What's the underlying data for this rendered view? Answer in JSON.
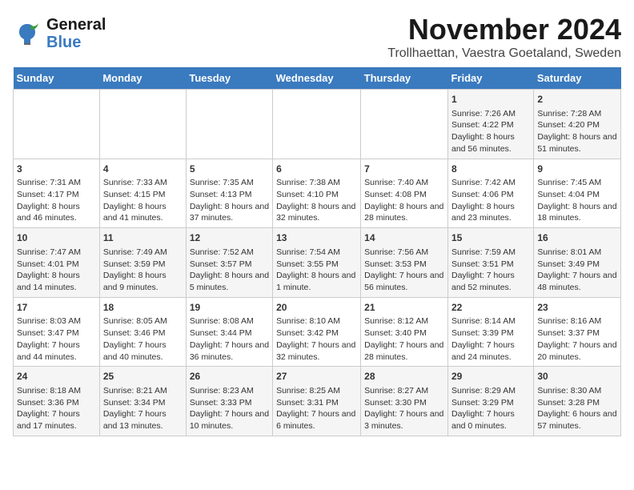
{
  "logo": {
    "text_general": "General",
    "text_blue": "Blue"
  },
  "title": "November 2024",
  "subtitle": "Trollhaettan, Vaestra Goetaland, Sweden",
  "days_of_week": [
    "Sunday",
    "Monday",
    "Tuesday",
    "Wednesday",
    "Thursday",
    "Friday",
    "Saturday"
  ],
  "weeks": [
    [
      {
        "day": "",
        "content": ""
      },
      {
        "day": "",
        "content": ""
      },
      {
        "day": "",
        "content": ""
      },
      {
        "day": "",
        "content": ""
      },
      {
        "day": "",
        "content": ""
      },
      {
        "day": "1",
        "content": "Sunrise: 7:26 AM\nSunset: 4:22 PM\nDaylight: 8 hours and 56 minutes."
      },
      {
        "day": "2",
        "content": "Sunrise: 7:28 AM\nSunset: 4:20 PM\nDaylight: 8 hours and 51 minutes."
      }
    ],
    [
      {
        "day": "3",
        "content": "Sunrise: 7:31 AM\nSunset: 4:17 PM\nDaylight: 8 hours and 46 minutes."
      },
      {
        "day": "4",
        "content": "Sunrise: 7:33 AM\nSunset: 4:15 PM\nDaylight: 8 hours and 41 minutes."
      },
      {
        "day": "5",
        "content": "Sunrise: 7:35 AM\nSunset: 4:13 PM\nDaylight: 8 hours and 37 minutes."
      },
      {
        "day": "6",
        "content": "Sunrise: 7:38 AM\nSunset: 4:10 PM\nDaylight: 8 hours and 32 minutes."
      },
      {
        "day": "7",
        "content": "Sunrise: 7:40 AM\nSunset: 4:08 PM\nDaylight: 8 hours and 28 minutes."
      },
      {
        "day": "8",
        "content": "Sunrise: 7:42 AM\nSunset: 4:06 PM\nDaylight: 8 hours and 23 minutes."
      },
      {
        "day": "9",
        "content": "Sunrise: 7:45 AM\nSunset: 4:04 PM\nDaylight: 8 hours and 18 minutes."
      }
    ],
    [
      {
        "day": "10",
        "content": "Sunrise: 7:47 AM\nSunset: 4:01 PM\nDaylight: 8 hours and 14 minutes."
      },
      {
        "day": "11",
        "content": "Sunrise: 7:49 AM\nSunset: 3:59 PM\nDaylight: 8 hours and 9 minutes."
      },
      {
        "day": "12",
        "content": "Sunrise: 7:52 AM\nSunset: 3:57 PM\nDaylight: 8 hours and 5 minutes."
      },
      {
        "day": "13",
        "content": "Sunrise: 7:54 AM\nSunset: 3:55 PM\nDaylight: 8 hours and 1 minute."
      },
      {
        "day": "14",
        "content": "Sunrise: 7:56 AM\nSunset: 3:53 PM\nDaylight: 7 hours and 56 minutes."
      },
      {
        "day": "15",
        "content": "Sunrise: 7:59 AM\nSunset: 3:51 PM\nDaylight: 7 hours and 52 minutes."
      },
      {
        "day": "16",
        "content": "Sunrise: 8:01 AM\nSunset: 3:49 PM\nDaylight: 7 hours and 48 minutes."
      }
    ],
    [
      {
        "day": "17",
        "content": "Sunrise: 8:03 AM\nSunset: 3:47 PM\nDaylight: 7 hours and 44 minutes."
      },
      {
        "day": "18",
        "content": "Sunrise: 8:05 AM\nSunset: 3:46 PM\nDaylight: 7 hours and 40 minutes."
      },
      {
        "day": "19",
        "content": "Sunrise: 8:08 AM\nSunset: 3:44 PM\nDaylight: 7 hours and 36 minutes."
      },
      {
        "day": "20",
        "content": "Sunrise: 8:10 AM\nSunset: 3:42 PM\nDaylight: 7 hours and 32 minutes."
      },
      {
        "day": "21",
        "content": "Sunrise: 8:12 AM\nSunset: 3:40 PM\nDaylight: 7 hours and 28 minutes."
      },
      {
        "day": "22",
        "content": "Sunrise: 8:14 AM\nSunset: 3:39 PM\nDaylight: 7 hours and 24 minutes."
      },
      {
        "day": "23",
        "content": "Sunrise: 8:16 AM\nSunset: 3:37 PM\nDaylight: 7 hours and 20 minutes."
      }
    ],
    [
      {
        "day": "24",
        "content": "Sunrise: 8:18 AM\nSunset: 3:36 PM\nDaylight: 7 hours and 17 minutes."
      },
      {
        "day": "25",
        "content": "Sunrise: 8:21 AM\nSunset: 3:34 PM\nDaylight: 7 hours and 13 minutes."
      },
      {
        "day": "26",
        "content": "Sunrise: 8:23 AM\nSunset: 3:33 PM\nDaylight: 7 hours and 10 minutes."
      },
      {
        "day": "27",
        "content": "Sunrise: 8:25 AM\nSunset: 3:31 PM\nDaylight: 7 hours and 6 minutes."
      },
      {
        "day": "28",
        "content": "Sunrise: 8:27 AM\nSunset: 3:30 PM\nDaylight: 7 hours and 3 minutes."
      },
      {
        "day": "29",
        "content": "Sunrise: 8:29 AM\nSunset: 3:29 PM\nDaylight: 7 hours and 0 minutes."
      },
      {
        "day": "30",
        "content": "Sunrise: 8:30 AM\nSunset: 3:28 PM\nDaylight: 6 hours and 57 minutes."
      }
    ]
  ]
}
